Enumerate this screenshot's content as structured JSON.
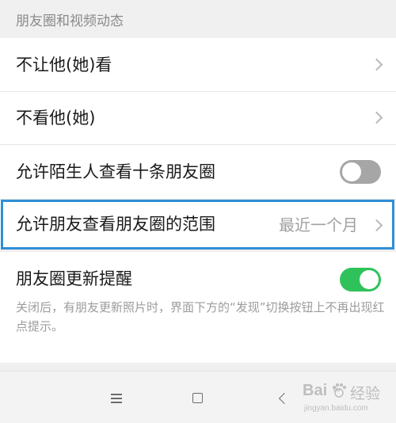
{
  "section": {
    "title": "朋友圈和视频动态"
  },
  "rows": {
    "hide_from": {
      "label": "不让他(她)看"
    },
    "dont_view": {
      "label": "不看他(她)"
    },
    "stranger_ten_posts": {
      "label": "允许陌生人查看十条朋友圈",
      "toggle": false
    },
    "visible_range": {
      "label": "允许朋友查看朋友圈的范围",
      "value": "最近一个月",
      "selected": true
    },
    "update_reminder": {
      "label": "朋友圈更新提醒",
      "toggle": true,
      "description": "关闭后，有朋友更新照片时，界面下方的“发现”切换按钮上不再出现红点提示。"
    }
  },
  "navbar": {
    "icons": [
      "menu-icon",
      "home-icon",
      "back-icon"
    ]
  },
  "watermark": {
    "text": "Bai",
    "paw": "du",
    "suffix": "经验",
    "url": "jingyan.baidu.com"
  },
  "colors": {
    "toggle_on": "#2fc25b",
    "toggle_off": "#a6a6a6",
    "selection_outline": "#2f8fd6"
  }
}
